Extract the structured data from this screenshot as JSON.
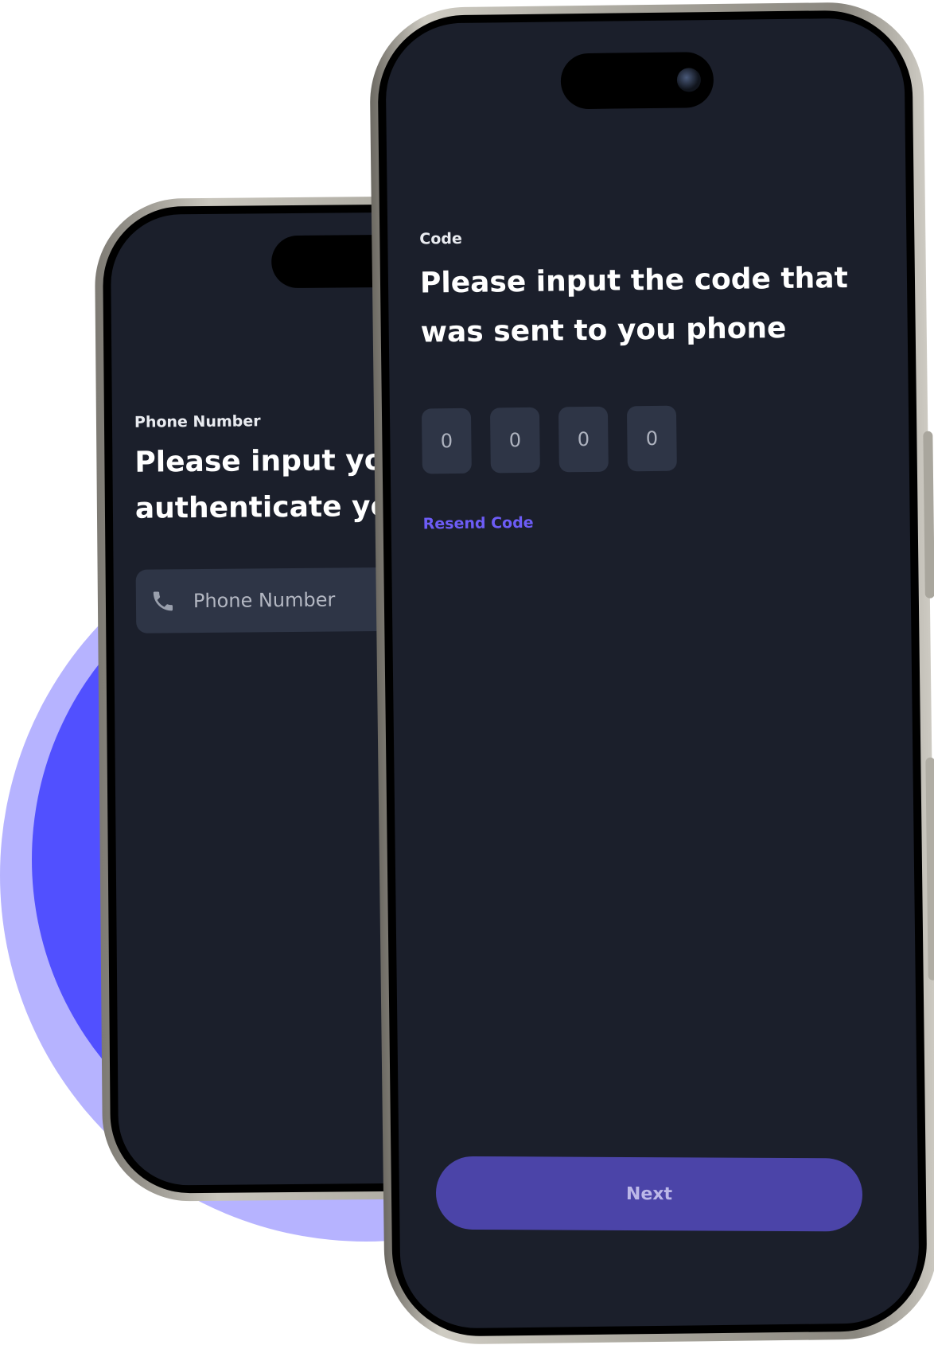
{
  "back_screen": {
    "label": "Phone Number",
    "title_line1": "Please input your",
    "title_line2": "authenticate you",
    "input_placeholder": "Phone Number",
    "input_icon": "phone-icon"
  },
  "front_screen": {
    "label": "Code",
    "title": "Please input the code that was sent to you phone",
    "code_digits": [
      "0",
      "0",
      "0",
      "0"
    ],
    "resend_label": "Resend Code",
    "next_label": "Next"
  },
  "colors": {
    "screen_background": "#1b1f2b",
    "input_background": "#2e3546",
    "accent": "#6d5cf6",
    "button": "#4b44a8",
    "circle_outer": "#b6b3ff",
    "circle_inner": "#5150ff"
  }
}
